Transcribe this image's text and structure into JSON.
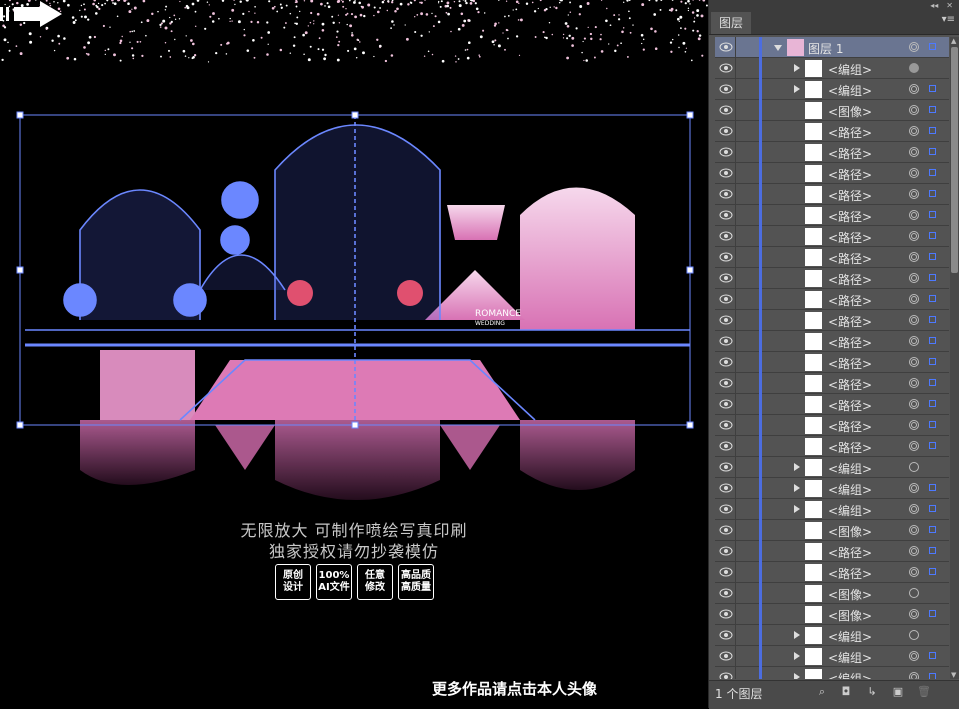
{
  "canvas": {
    "caption_line1": "无限放大  可制作喷绘写真印刷",
    "caption_line2": "独家授权请勿抄袭模仿",
    "badges": [
      {
        "label": "原创\n设计"
      },
      {
        "label": "100%\nAI文件"
      },
      {
        "label": "任意\n修改"
      },
      {
        "label": "高品质\n高质量"
      }
    ],
    "promo_text": "更多作品请点击本人头像",
    "artwork_text_1": "ROMANCE",
    "artwork_text_2": "WEDDING",
    "selection_color": "#6b87ff",
    "accent_pink": "#e79ac7"
  },
  "panel": {
    "tab_label": "图层",
    "collapse_icon": "double-chevron-icon",
    "menu_icon": "panel-menu-icon",
    "layers": [
      {
        "name": "图层 1",
        "type": "layer",
        "expanded": true,
        "selected": true,
        "target": "ring"
      },
      {
        "name": "<编组>",
        "type": "group",
        "target": "filled"
      },
      {
        "name": "<编组>",
        "type": "group",
        "target": "ring"
      },
      {
        "name": "<图像>",
        "type": "image",
        "target": "ring"
      },
      {
        "name": "<路径>",
        "type": "path",
        "target": "ring"
      },
      {
        "name": "<路径>",
        "type": "path",
        "target": "ring"
      },
      {
        "name": "<路径>",
        "type": "path",
        "target": "ring"
      },
      {
        "name": "<路径>",
        "type": "path",
        "target": "ring"
      },
      {
        "name": "<路径>",
        "type": "path",
        "target": "ring"
      },
      {
        "name": "<路径>",
        "type": "path",
        "target": "ring"
      },
      {
        "name": "<路径>",
        "type": "path",
        "target": "ring"
      },
      {
        "name": "<路径>",
        "type": "path",
        "target": "ring"
      },
      {
        "name": "<路径>",
        "type": "path",
        "target": "ring"
      },
      {
        "name": "<路径>",
        "type": "path",
        "target": "ring"
      },
      {
        "name": "<路径>",
        "type": "path",
        "target": "ring"
      },
      {
        "name": "<路径>",
        "type": "path",
        "target": "ring"
      },
      {
        "name": "<路径>",
        "type": "path",
        "target": "ring"
      },
      {
        "name": "<路径>",
        "type": "path",
        "target": "ring"
      },
      {
        "name": "<路径>",
        "type": "path",
        "target": "ring"
      },
      {
        "name": "<路径>",
        "type": "path",
        "target": "ring"
      },
      {
        "name": "<编组>",
        "type": "group",
        "target": "empty"
      },
      {
        "name": "<编组>",
        "type": "group",
        "target": "ring"
      },
      {
        "name": "<编组>",
        "type": "group",
        "target": "ring"
      },
      {
        "name": "<图像>",
        "type": "image",
        "target": "ring"
      },
      {
        "name": "<路径>",
        "type": "path",
        "target": "ring"
      },
      {
        "name": "<路径>",
        "type": "path",
        "target": "ring"
      },
      {
        "name": "<图像>",
        "type": "image",
        "target": "empty"
      },
      {
        "name": "<图像>",
        "type": "image",
        "target": "ring"
      },
      {
        "name": "<编组>",
        "type": "group",
        "target": "empty"
      },
      {
        "name": "<编组>",
        "type": "group",
        "target": "ring"
      },
      {
        "name": "<编组>",
        "type": "group",
        "target": "ring"
      }
    ],
    "footer_count": "1 个图层",
    "footer_icons": [
      "locate-object-icon",
      "make-clipping-mask-icon",
      "create-sublayer-icon",
      "new-layer-icon",
      "delete-icon"
    ],
    "layer_accent": "#4c6de0",
    "selected_row_color": "#6a7591"
  }
}
